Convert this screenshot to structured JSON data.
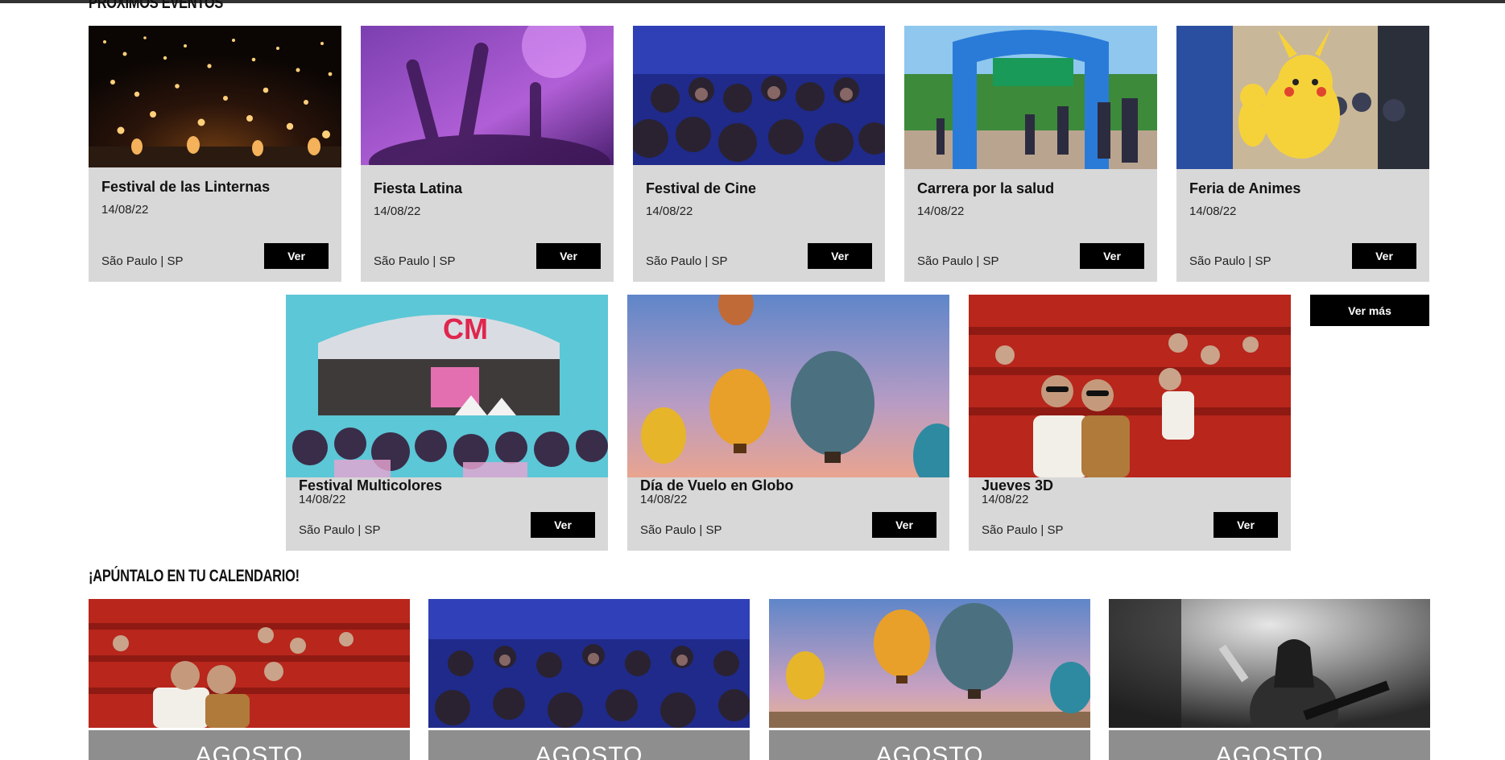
{
  "sections": {
    "upcoming_title": "PRÓXIMOS EVENTOS",
    "calendar_title": "¡APÚNTALO EN TU CALENDARIO!"
  },
  "events_row1": [
    {
      "title": "Festival de las Linternas",
      "date": "14/08/22",
      "location": "São Paulo | SP",
      "button": "Ver"
    },
    {
      "title": "Fiesta Latina",
      "date": "14/08/22",
      "location": "São Paulo | SP",
      "button": "Ver"
    },
    {
      "title": "Festival de Cine",
      "date": "14/08/22",
      "location": "São Paulo | SP",
      "button": "Ver"
    },
    {
      "title": "Carrera por la salud",
      "date": "14/08/22",
      "location": "São Paulo | SP",
      "button": "Ver"
    },
    {
      "title": "Feria de Animes",
      "date": "14/08/22",
      "location": "São Paulo | SP",
      "button": "Ver"
    }
  ],
  "events_row2": [
    {
      "title": "Festival Multicolores",
      "date": "14/08/22",
      "location": "São Paulo | SP",
      "button": "Ver"
    },
    {
      "title": "Día de Vuelo en Globo",
      "date": "14/08/22",
      "location": "São Paulo | SP",
      "button": "Ver"
    },
    {
      "title": "Jueves 3D",
      "date": "14/08/22",
      "location": "São Paulo | SP",
      "button": "Ver"
    }
  ],
  "more_button": "Ver más",
  "calendar": [
    {
      "month": "AGOSTO"
    },
    {
      "month": "AGOSTO"
    },
    {
      "month": "AGOSTO"
    },
    {
      "month": "AGOSTO"
    }
  ],
  "colors": {
    "card_bg": "#d8d8d8",
    "button_bg": "#000000",
    "month_bg": "#8e8e8e"
  }
}
